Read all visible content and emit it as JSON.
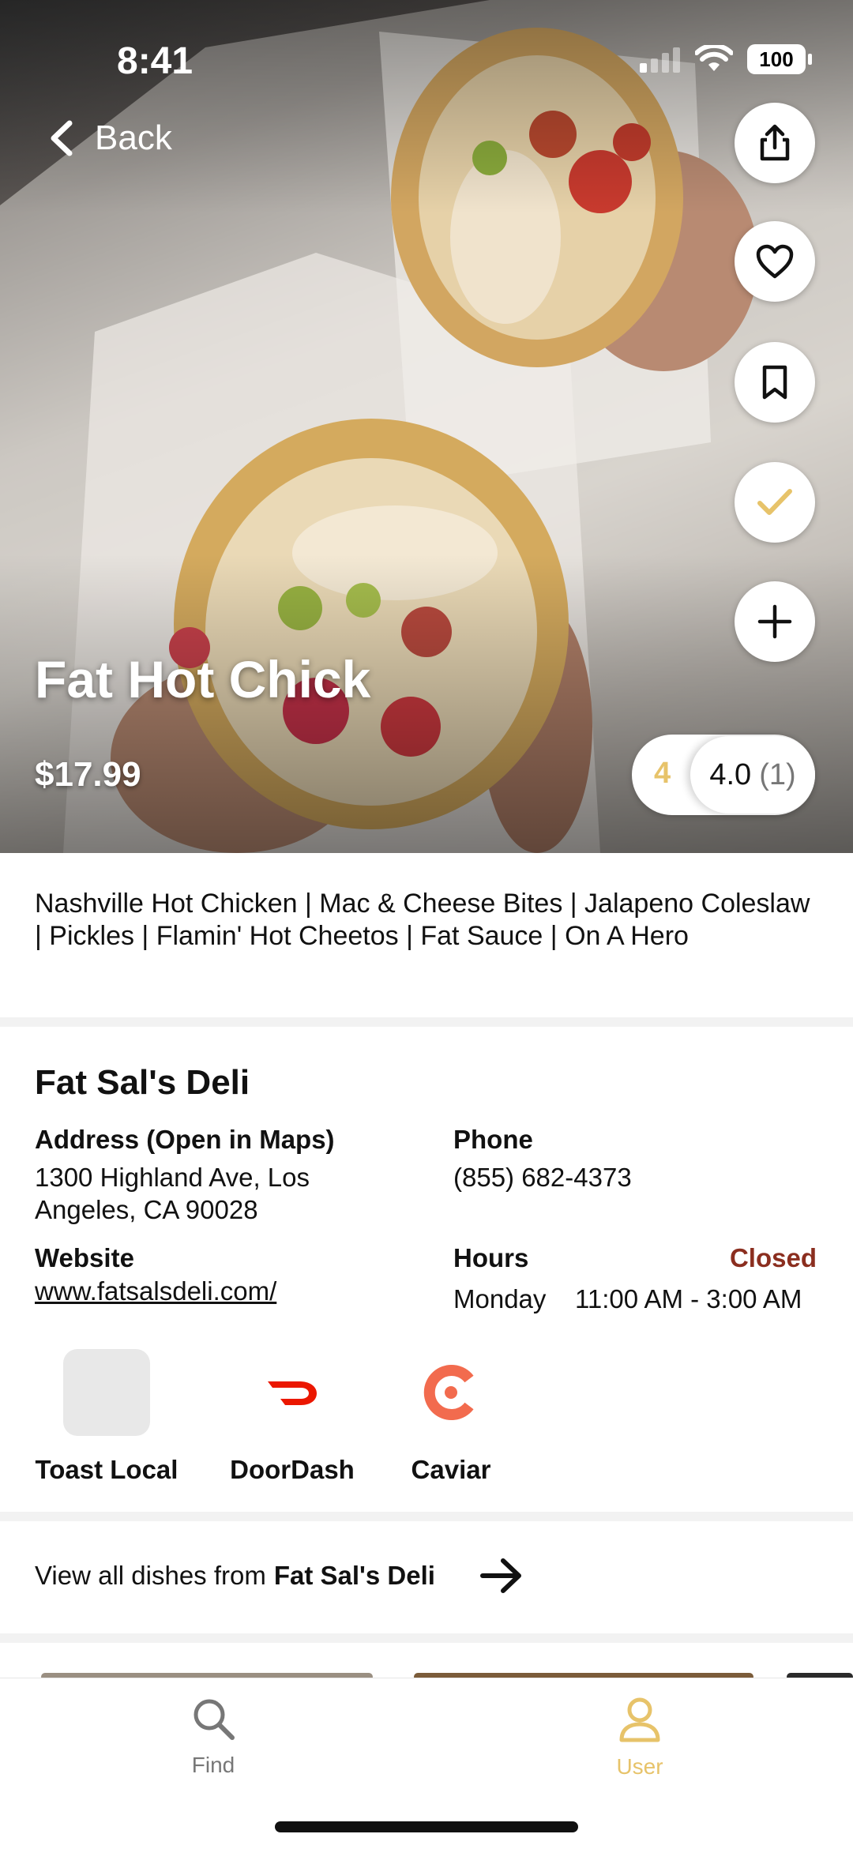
{
  "status_bar": {
    "time": "8:41",
    "battery": "100"
  },
  "nav": {
    "back_label": "Back"
  },
  "hero_actions": [
    {
      "name": "share-button",
      "icon": "share-icon"
    },
    {
      "name": "favorite-button",
      "icon": "heart-icon"
    },
    {
      "name": "bookmark-button",
      "icon": "bookmark-icon"
    },
    {
      "name": "tried-button",
      "icon": "check-icon"
    },
    {
      "name": "add-button",
      "icon": "plus-icon"
    }
  ],
  "dish": {
    "title": "Fat Hot Chick",
    "price": "$17.99",
    "rating_user": "4",
    "rating_avg": "4.0",
    "rating_count": "(1)",
    "ingredients": "Nashville Hot Chicken | Mac & Cheese Bites | Jalapeno Coleslaw | Pickles | Flamin' Hot Cheetos | Fat Sauce | On A Hero"
  },
  "restaurant": {
    "name": "Fat Sal's Deli",
    "address_label": "Address (Open in Maps)",
    "address_line1": "1300 Highland Ave, Los",
    "address_line2": "Angeles, CA 90028",
    "phone_label": "Phone",
    "phone": "(855) 682-4373",
    "website_label": "Website",
    "website": "www.fatsalsdeli.com/",
    "hours_label": "Hours",
    "status": "Closed",
    "hours_day": "Monday",
    "hours_time": "11:00 AM - 3:00 AM"
  },
  "delivery": [
    {
      "name": "Toast Local"
    },
    {
      "name": "DoorDash"
    },
    {
      "name": "Caviar"
    }
  ],
  "view_all": {
    "prefix": "View all dishes from",
    "restaurant": "Fat Sal's Deli"
  },
  "tabs": [
    {
      "label": "Find",
      "icon": "search-icon"
    },
    {
      "label": "User",
      "icon": "user-icon"
    }
  ],
  "colors": {
    "accent": "#E7C36A",
    "closed": "#8B2E1F",
    "doordash": "#EB1700",
    "caviar": "#F26B4E"
  }
}
